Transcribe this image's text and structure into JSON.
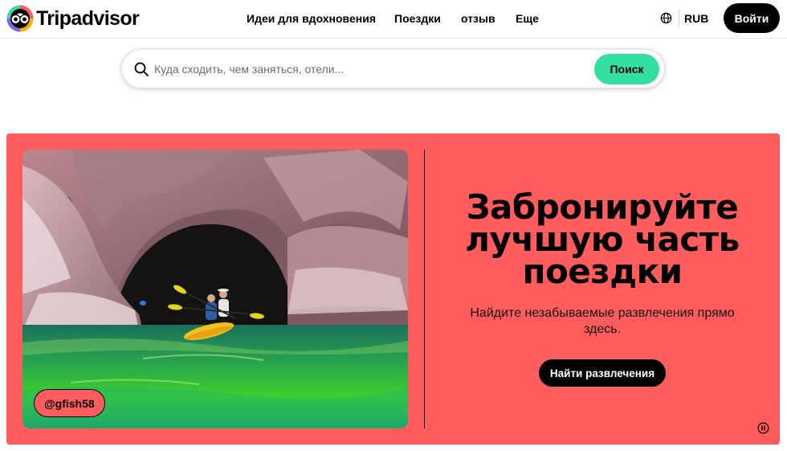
{
  "header": {
    "brand": "Tripadvisor",
    "nav": [
      {
        "label": "Идеи для вдохновения"
      },
      {
        "label": "Поездки"
      },
      {
        "label": "отзыв"
      },
      {
        "label": "Еще"
      }
    ],
    "currency": "RUB",
    "login_label": "Войти"
  },
  "search": {
    "placeholder": "Куда сходить, чем заняться, отели...",
    "value": "",
    "button_label": "Поиск"
  },
  "hero": {
    "photo_credit": "@gfish58",
    "headline": "Забронируйте лучшую часть поездки",
    "subtext": "Найдите незабываемые развлечения прямо здесь.",
    "cta_label": "Найти развлечения"
  },
  "colors": {
    "hero_bg": "#ff5d5d",
    "search_button": "#34e0a1",
    "primary_dark": "#000000"
  },
  "icons": [
    "tripadvisor-owl-logo-icon",
    "globe-icon",
    "search-icon",
    "pause-icon"
  ]
}
